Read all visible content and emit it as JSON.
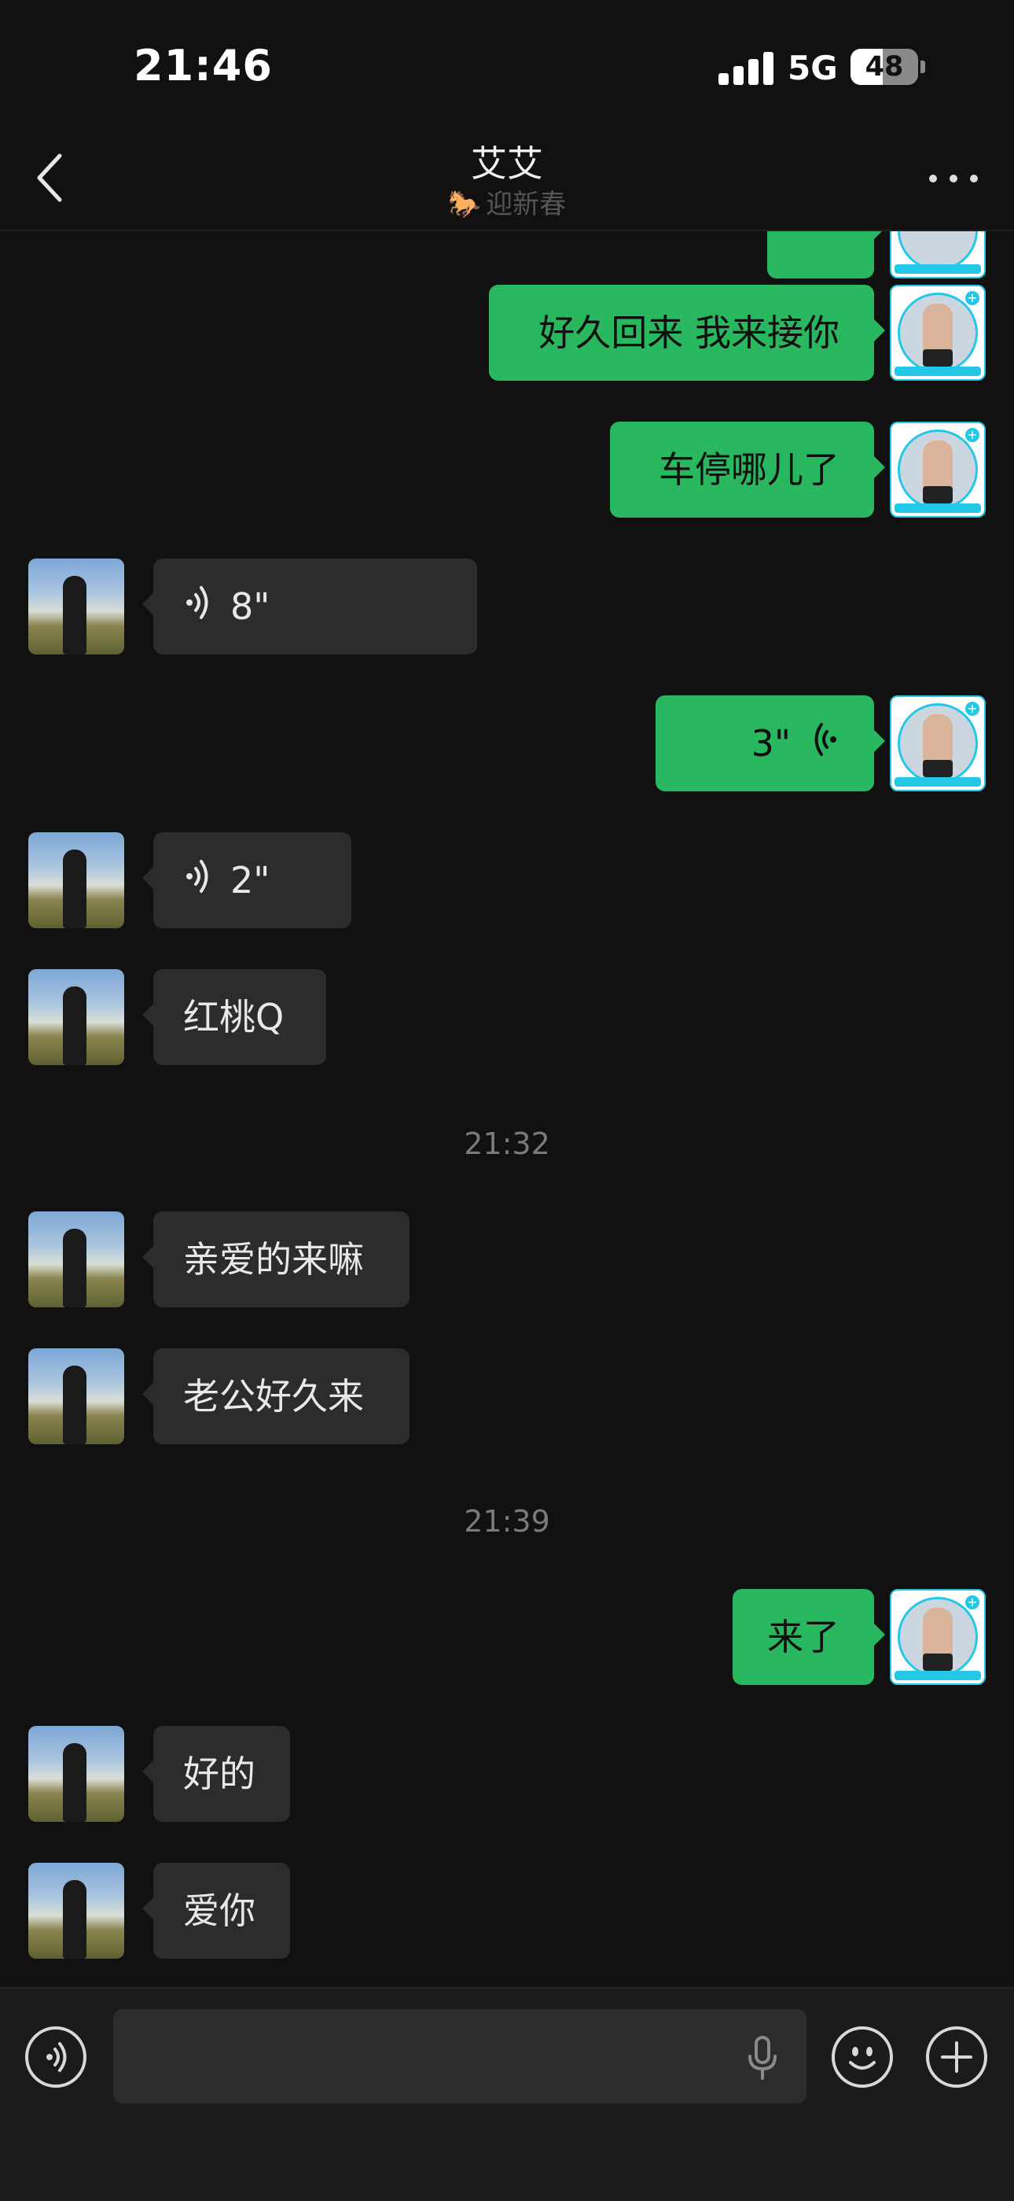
{
  "status_bar": {
    "time": "21:46",
    "network": "5G",
    "battery": "48",
    "battery_level": 0.48
  },
  "header": {
    "title": "艾艾",
    "subtitle": "迎新春",
    "back_icon": "chevron-left-icon",
    "more_icon": "ellipsis-icon"
  },
  "messages": [
    {
      "side": "out",
      "kind": "text",
      "text": "好久回来 我来接你"
    },
    {
      "side": "out",
      "kind": "text",
      "text": "车停哪儿了"
    },
    {
      "side": "in",
      "kind": "voice",
      "duration": "8\""
    },
    {
      "side": "out",
      "kind": "voice",
      "duration": "3\""
    },
    {
      "side": "in",
      "kind": "voice",
      "duration": "2\""
    },
    {
      "side": "in",
      "kind": "text",
      "text": "红桃Q"
    },
    {
      "kind": "time",
      "text": "21:32"
    },
    {
      "side": "in",
      "kind": "text",
      "text": "亲爱的来嘛"
    },
    {
      "side": "in",
      "kind": "text",
      "text": "老公好久来"
    },
    {
      "kind": "time",
      "text": "21:39"
    },
    {
      "side": "out",
      "kind": "text",
      "text": "来了"
    },
    {
      "side": "in",
      "kind": "text",
      "text": "好的"
    },
    {
      "side": "in",
      "kind": "text",
      "text": "爱你"
    }
  ],
  "input_bar": {
    "voice_icon": "voice-mode-icon",
    "mic_icon": "microphone-icon",
    "emoji_icon": "emoji-icon",
    "plus_icon": "plus-icon"
  },
  "colors": {
    "outgoing_bubble": "#29b75f",
    "incoming_bubble": "#2c2c2c",
    "background": "#111111"
  }
}
